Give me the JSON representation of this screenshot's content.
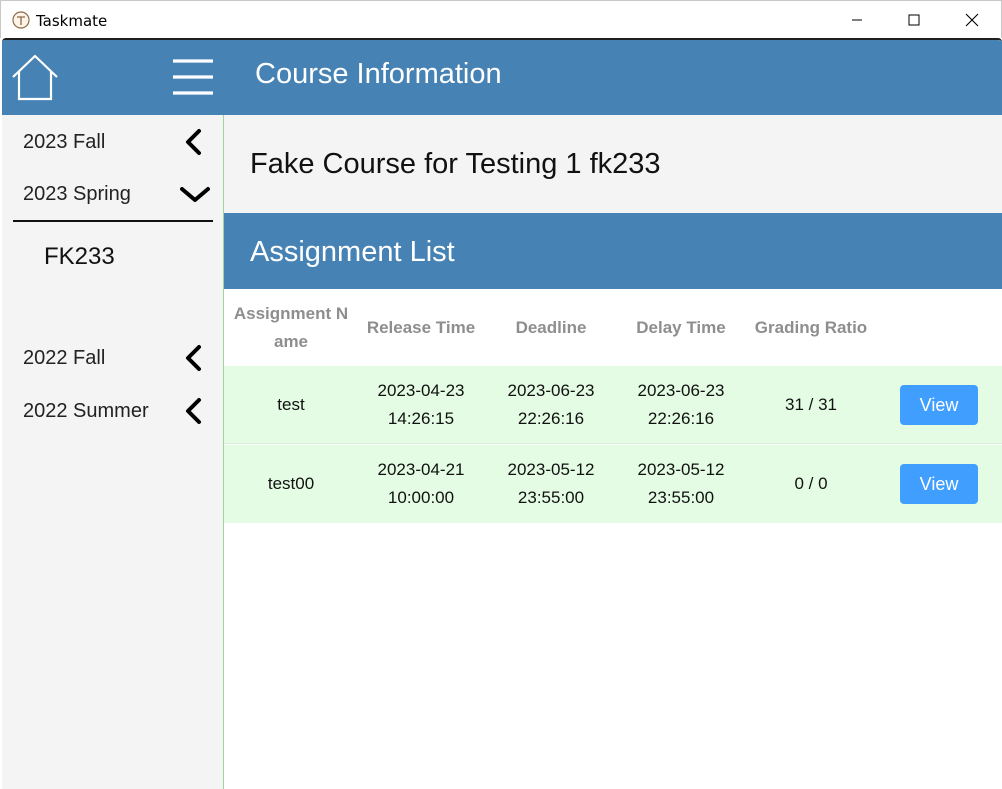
{
  "window": {
    "title": "Taskmate"
  },
  "header": {
    "title": "Course Information"
  },
  "sidebar": {
    "terms": [
      {
        "label": "2023 Fall",
        "expanded": false
      },
      {
        "label": "2023 Spring",
        "expanded": true
      },
      {
        "label": "2022 Fall",
        "expanded": false
      },
      {
        "label": "2022 Summer",
        "expanded": false
      }
    ],
    "courses": [
      "FK233"
    ]
  },
  "course": {
    "name": "Fake Course for Testing 1 fk233"
  },
  "assignments": {
    "title": "Assignment List",
    "columns": [
      "Assignment Name",
      "Release Time",
      "Deadline",
      "Delay Time",
      "Grading Ratio"
    ],
    "rows": [
      {
        "name": "test",
        "release": "2023-04-23 14:26:15",
        "deadline": "2023-06-23 22:26:16",
        "delay": "2023-06-23 22:26:16",
        "ratio": "31 / 31",
        "action": "View"
      },
      {
        "name": "test00",
        "release": "2023-04-21 10:00:00",
        "deadline": "2023-05-12 23:55:00",
        "delay": "2023-05-12 23:55:00",
        "ratio": "0 / 0",
        "action": "View"
      }
    ]
  },
  "colors": {
    "accent": "#4682b4",
    "button": "#409eff",
    "row_bg": "#e3fce3",
    "sidebar_bg": "#f4f4f4"
  }
}
